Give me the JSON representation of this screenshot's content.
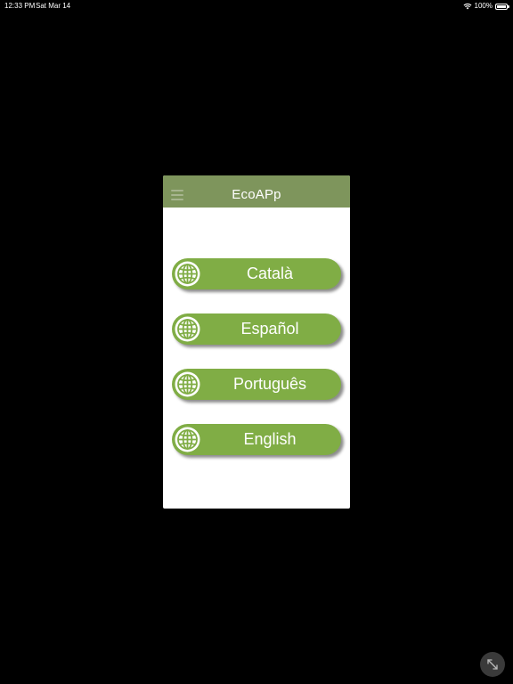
{
  "status_bar": {
    "time": "12:33 PM",
    "date": "Sat Mar 14",
    "battery": "100%",
    "icons": [
      "wifi-icon",
      "battery-icon"
    ]
  },
  "app": {
    "title": "EcoAPp",
    "menu_icon": "hamburger-menu-icon",
    "header_color": "#7e955c",
    "button_color": "#80ad45"
  },
  "languages": [
    {
      "label": "Català",
      "icon": "globe-icon"
    },
    {
      "label": "Español",
      "icon": "globe-icon"
    },
    {
      "label": "Português",
      "icon": "globe-icon"
    },
    {
      "label": "English",
      "icon": "globe-icon"
    }
  ],
  "overlay": {
    "expand_icon": "expand-arrows-icon"
  }
}
